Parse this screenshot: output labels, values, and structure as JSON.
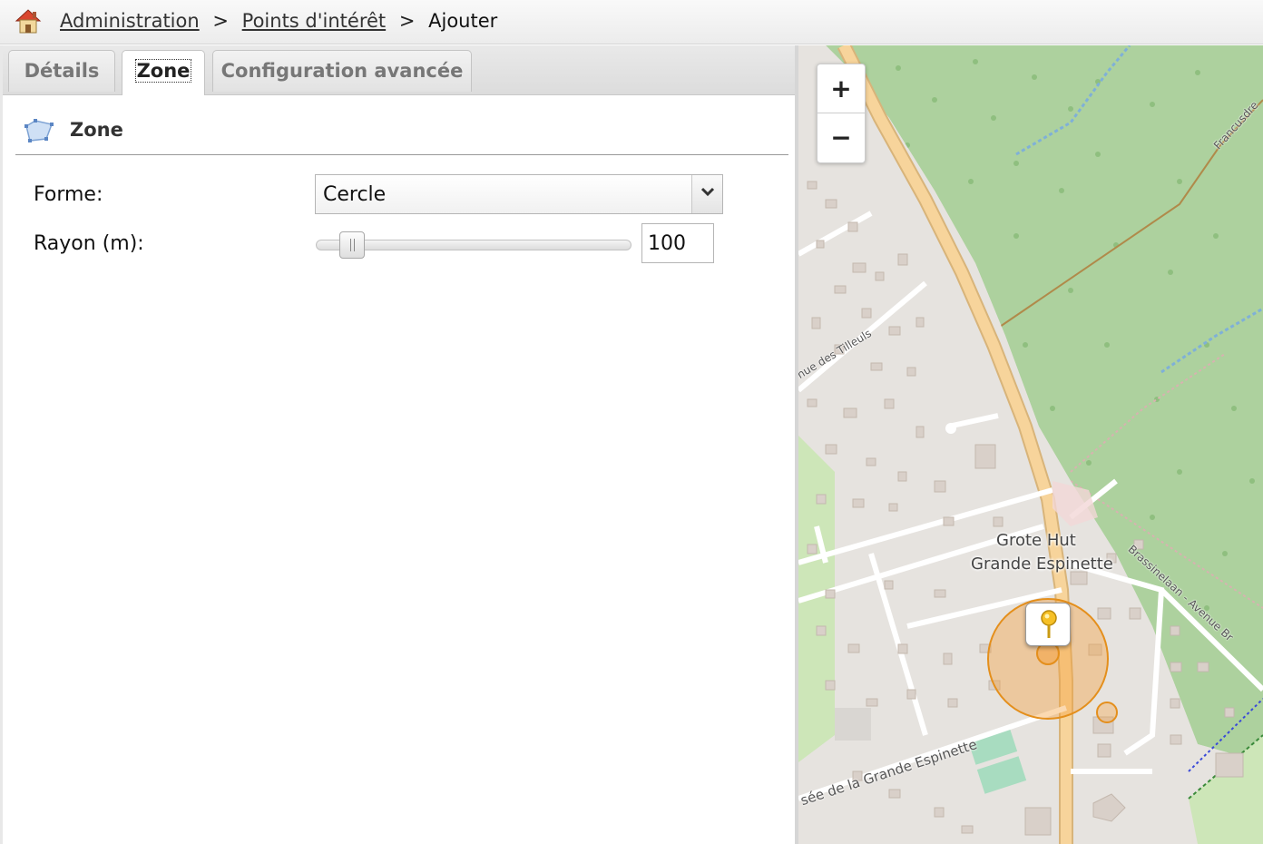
{
  "breadcrumb": {
    "items": [
      "Administration",
      "Points d'intérêt",
      "Ajouter"
    ],
    "separator": ">"
  },
  "tabs": [
    {
      "label": "Détails",
      "active": false
    },
    {
      "label": "Zone",
      "active": true
    },
    {
      "label": "Configuration avancée",
      "active": false
    }
  ],
  "section": {
    "title": "Zone",
    "icon": "polygon-zone-icon"
  },
  "form": {
    "shape_label": "Forme:",
    "shape_value": "Cercle",
    "radius_label": "Rayon (m):",
    "radius_value": "100",
    "radius_slider_level": 0.08
  },
  "map": {
    "zoom_in_label": "+",
    "zoom_out_label": "−",
    "place_label_1": "Grote Hut",
    "place_label_2": "Grande Espinette",
    "street_1": "nue des Tilleuls",
    "street_2": "sée de la Grande Espinette",
    "street_3": "Brassinelaan - Avenue Br",
    "street_4": "Francusdre",
    "colors": {
      "forest": "#add19e",
      "road": "#f7d49b",
      "zone": "#f5a03c"
    }
  }
}
